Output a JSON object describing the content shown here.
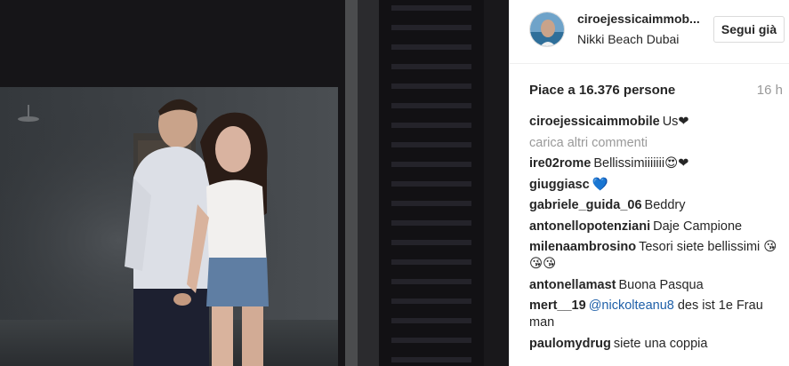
{
  "post": {
    "username": "ciroejessicaimmob...",
    "location": "Nikki Beach Dubai",
    "follow_label": "Segui già",
    "likes_text": "Piace a 16.376 persone",
    "time_text": "16 h"
  },
  "caption": {
    "user": "ciroejessicaimmobile",
    "text": "Us❤"
  },
  "load_more_label": "carica altri commenti",
  "comments": [
    {
      "user": "ire02rome",
      "text": "Bellissimiiiiiii😍❤"
    },
    {
      "user": "giuggiasc",
      "text": "💙"
    },
    {
      "user": "gabriele_guida_06",
      "text": "Beddry"
    },
    {
      "user": "antonellopotenziani",
      "text": "Daje Campione"
    },
    {
      "user": "milenaambrosino",
      "text": "Tesori siete bellissimi 😘😘😘"
    },
    {
      "user": "antonellamast",
      "text": "Buona Pasqua"
    },
    {
      "user": "mert__19",
      "mention": "@nickolteanu8",
      "text": " des ist 1e Frau man"
    },
    {
      "user": "paulomydrug",
      "text": "siete una coppia"
    }
  ],
  "colors": {
    "mention": "#1e5fa8",
    "muted": "#999999",
    "border": "#dbdbdb"
  },
  "icons": {
    "photo": "couple-photo"
  }
}
